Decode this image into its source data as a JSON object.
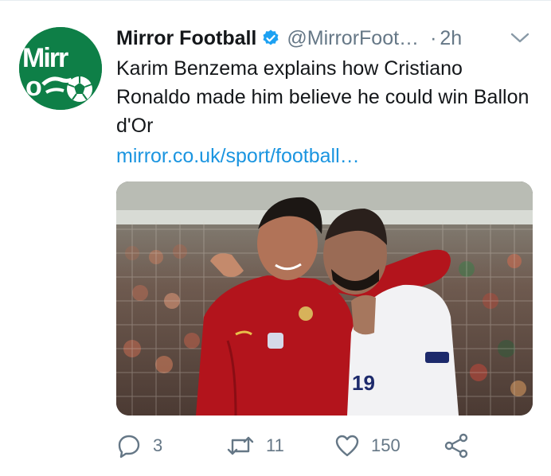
{
  "account": {
    "display_name": "Mirror Football",
    "handle": "@MirrorFoot…",
    "separator": "·",
    "time": "2h",
    "avatar_logo_text": "Mirror"
  },
  "tweet": {
    "text": "Karim Benzema explains how Cristiano Ronaldo made him believe he could win Ballon d'Or",
    "link": "mirror.co.uk/sport/football…",
    "media": {
      "shirt_number": "19"
    }
  },
  "actions": {
    "reply_count": "3",
    "retweet_count": "11",
    "like_count": "150"
  },
  "colors": {
    "link": "#1b95e0",
    "secondary_text": "#657786",
    "verified": "#1da1f2",
    "avatar_bg": "#0e7f47"
  },
  "icons": [
    "verified-badge-icon",
    "chevron-down-icon",
    "reply-icon",
    "retweet-icon",
    "like-icon",
    "share-icon"
  ]
}
